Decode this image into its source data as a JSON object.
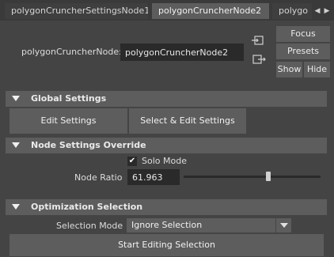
{
  "tabs": [
    {
      "label": "polygonCruncherSettingsNode1",
      "active": false
    },
    {
      "label": "polygonCruncherNode2",
      "active": true
    },
    {
      "label": "polygo",
      "active": false
    }
  ],
  "tab_scroll": {
    "left_icon": "triangle-left-icon",
    "right_icon": "triangle-right-icon"
  },
  "node": {
    "label": "polygonCruncherNode:",
    "value": "polygonCruncherNode2",
    "input_icon": "input-connection-icon",
    "output_icon": "output-connection-icon"
  },
  "side_buttons": {
    "focus": "Focus",
    "presets": "Presets",
    "show": "Show",
    "hide": "Hide"
  },
  "global_settings": {
    "header": "Global Settings",
    "edit_settings": "Edit Settings",
    "select_edit_settings": "Select & Edit Settings"
  },
  "node_settings": {
    "header": "Node Settings Override",
    "solo_mode_label": "Solo Mode",
    "solo_mode_checked": true,
    "checkmark": "✔",
    "node_ratio_label": "Node Ratio",
    "node_ratio_value": "61.963",
    "node_ratio_slider_fraction": 0.62
  },
  "optimization": {
    "header": "Optimization Selection",
    "selection_mode_label": "Selection Mode",
    "selection_mode_value": "Ignore Selection",
    "start_button": "Start Editing Selection"
  }
}
